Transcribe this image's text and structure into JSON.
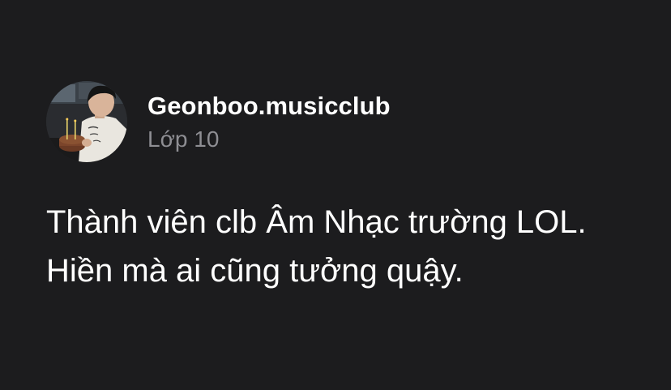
{
  "profile": {
    "name": "Geonboo.musicclub",
    "subtitle": "Lớp 10",
    "avatar_icon": "profile-photo"
  },
  "bio": {
    "lines": [
      "Thành viên clb Âm Nhạc trường LOL.",
      "Hiền mà ai cũng tưởng quậy."
    ]
  },
  "colors": {
    "background": "#1c1c1e",
    "primary_text": "#ffffff",
    "secondary_text": "#8e8e93"
  }
}
